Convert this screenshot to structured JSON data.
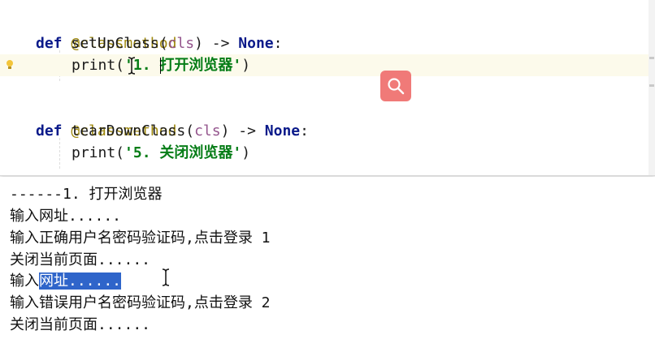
{
  "editor": {
    "line1": {
      "decorator": "@classmethod"
    },
    "line2": {
      "def": "def",
      "name": " setUpClass(",
      "param": "cls",
      "rest": ") -> ",
      "none": "None",
      "colon": ":"
    },
    "line3": {
      "print": "print(",
      "string": "'1. 打开浏览器'",
      "close": ")"
    },
    "line4": {
      "decorator": "@classmethod"
    },
    "line5": {
      "def": "def",
      "name": " tearDownClass(",
      "param": "cls",
      "rest": ") -> ",
      "none": "None",
      "colon": ":"
    },
    "line6": {
      "print": "print(",
      "string": "'5. 关闭浏览器'",
      "close": ")"
    }
  },
  "icons": {
    "bulb": "lightbulb-icon",
    "search": "search-icon",
    "text_cursor": "text-cursor-icon"
  },
  "colors": {
    "decorator": "#9e880d",
    "keyword": "#0a1a8a",
    "string": "#067d17",
    "param": "#94558d",
    "search_button": "#f07a78",
    "selection": "#2f65ca"
  },
  "console": {
    "lines": [
      "------1. 打开浏览器",
      "输入网址......",
      "输入正确用户名密码验证码,点击登录 1",
      "关闭当前页面......",
      "输入",
      "输入错误用户名密码验证码,点击登录 2",
      "关闭当前页面......"
    ],
    "selected_text": "网址......"
  }
}
